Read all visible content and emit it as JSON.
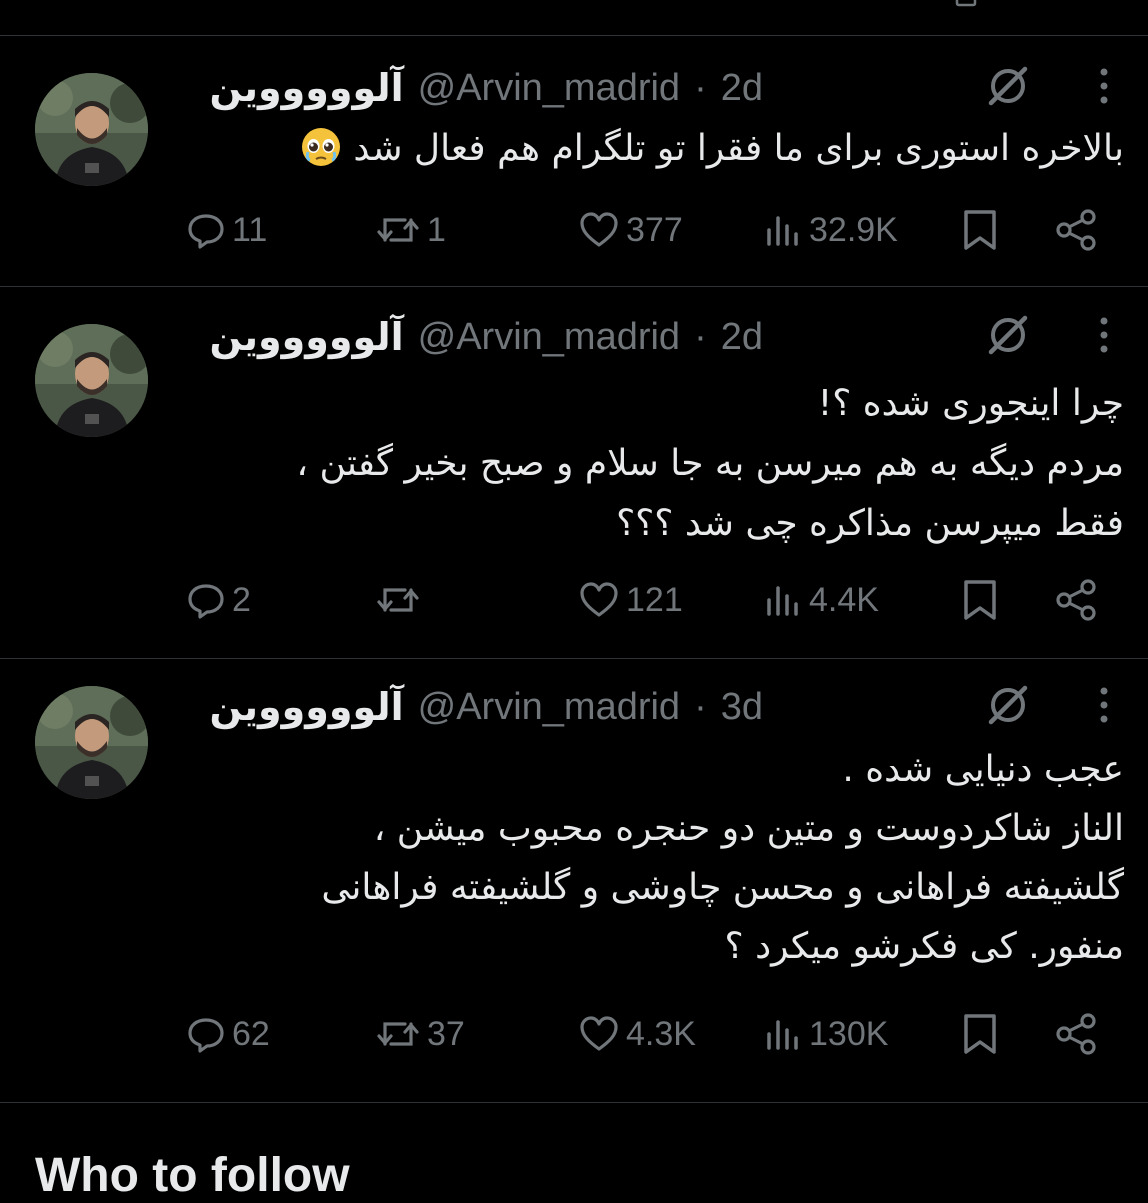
{
  "tweets": [
    {
      "display_name": "آلوووووین",
      "handle": "@Arvin_madrid",
      "time_sep": "·",
      "time": "2d",
      "text_lines": [
        "بالاخره استوری برای ما فقرا تو تلگرام هم فعال شد"
      ],
      "emoji": "pleading-face",
      "replies": "11",
      "reposts": "1",
      "likes": "377",
      "views": "32.9K"
    },
    {
      "display_name": "آلوووووین",
      "handle": "@Arvin_madrid",
      "time_sep": "·",
      "time": "2d",
      "text_lines": [
        "چرا اینجوری شده ؟!",
        "مردم دیگه به هم میرسن به جا سلام و صبح بخیر گفتن ،",
        "فقط میپرسن مذاکره چی شد ؟؟؟"
      ],
      "replies": "2",
      "reposts": "",
      "likes": "121",
      "views": "4.4K"
    },
    {
      "display_name": "آلوووووین",
      "handle": "@Arvin_madrid",
      "time_sep": "·",
      "time": "3d",
      "text_lines": [
        "عجب دنیایی شده .",
        "الناز شاکردوست و متین دو حنجره محبوب میشن ،",
        "گلشیفته فراهانی و محسن چاوشی و گلشیفته فراهانی",
        "منفور. کی فکرشو میکرد ؟"
      ],
      "replies": "62",
      "reposts": "37",
      "likes": "4.3K",
      "views": "130K"
    }
  ],
  "who_to_follow": "Who to follow",
  "icons": {
    "grok": "grok-icon",
    "more": "more-icon",
    "reply": "reply-icon",
    "repost": "repost-icon",
    "like": "heart-icon",
    "views": "views-icon",
    "bookmark": "bookmark-icon",
    "share": "share-icon"
  },
  "colors": {
    "background": "#000000",
    "text": "#e7e9ea",
    "secondary": "#71767b",
    "divider": "#2f3336"
  }
}
